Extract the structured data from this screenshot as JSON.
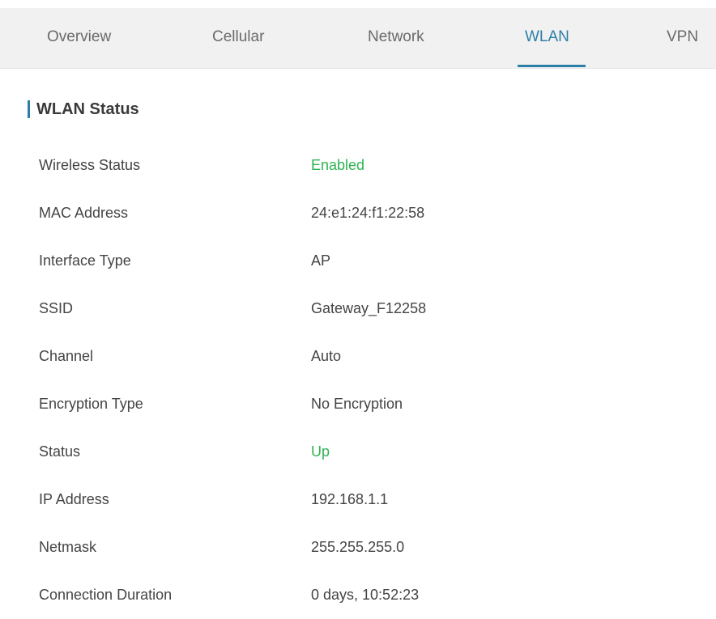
{
  "tabs": [
    {
      "label": "Overview",
      "active": false
    },
    {
      "label": "Cellular",
      "active": false
    },
    {
      "label": "Network",
      "active": false
    },
    {
      "label": "WLAN",
      "active": true
    },
    {
      "label": "VPN",
      "active": false
    }
  ],
  "section": {
    "title": "WLAN Status"
  },
  "rows": [
    {
      "label": "Wireless Status",
      "value": "Enabled",
      "status": "ok"
    },
    {
      "label": "MAC Address",
      "value": "24:e1:24:f1:22:58"
    },
    {
      "label": "Interface Type",
      "value": "AP"
    },
    {
      "label": "SSID",
      "value": "Gateway_F12258"
    },
    {
      "label": "Channel",
      "value": "Auto"
    },
    {
      "label": "Encryption Type",
      "value": "No Encryption"
    },
    {
      "label": "Status",
      "value": "Up",
      "status": "ok"
    },
    {
      "label": "IP Address",
      "value": "192.168.1.1"
    },
    {
      "label": "Netmask",
      "value": "255.255.255.0"
    },
    {
      "label": "Connection Duration",
      "value": "0 days, 10:52:23"
    }
  ],
  "colors": {
    "accent": "#2d7fa7",
    "status_ok": "#2fb352",
    "tabbar_bg": "#f1f1f1",
    "text": "#444444"
  }
}
